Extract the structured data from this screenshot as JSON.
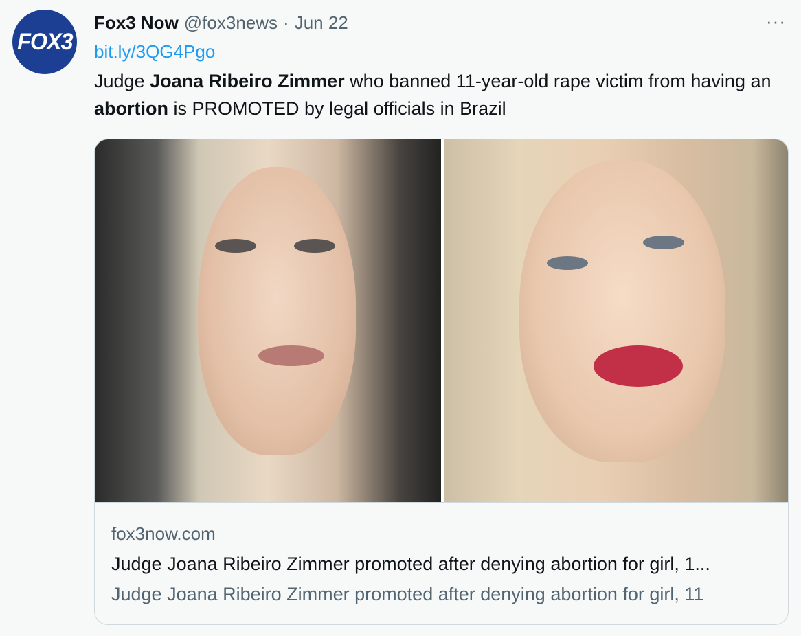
{
  "author": {
    "avatar_text": "FOX3",
    "display_name": "Fox3 Now",
    "handle": "@fox3news",
    "separator": "·",
    "date": "Jun 22"
  },
  "more_label": "···",
  "tweet": {
    "link": "bit.ly/3QG4Pgo",
    "text_parts": [
      {
        "text": "Judge ",
        "bold": false
      },
      {
        "text": "Joana Ribeiro Zimmer",
        "bold": true
      },
      {
        "text": " who banned 11-year-old rape victim from having an ",
        "bold": false
      },
      {
        "text": "abortion",
        "bold": true
      },
      {
        "text": " is PROMOTED by legal officials in Brazil",
        "bold": false
      }
    ]
  },
  "card": {
    "domain": "fox3now.com",
    "title": "Judge Joana Ribeiro Zimmer promoted after denying abortion for girl, 1...",
    "description": "Judge Joana Ribeiro Zimmer promoted after denying abortion for girl, 11"
  },
  "colors": {
    "link": "#1d9bf0",
    "secondary_text": "#536471",
    "avatar_bg": "#1c3f94"
  }
}
